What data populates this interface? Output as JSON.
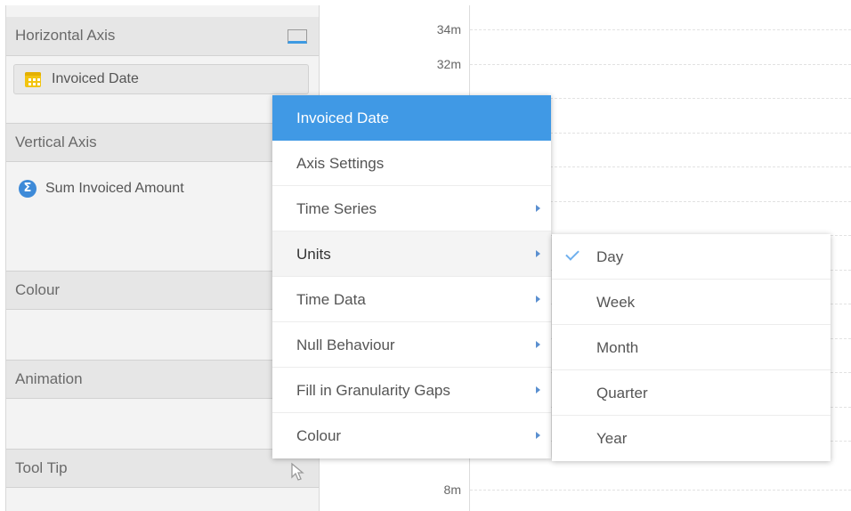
{
  "left_panel": {
    "horizontal_axis": {
      "title": "Horizontal Axis",
      "icon": "monitor-icon",
      "field": {
        "label": "Invoiced Date",
        "icon": "calendar-icon",
        "accent": "#f2c40f"
      }
    },
    "vertical_axis": {
      "title": "Vertical Axis",
      "field": {
        "label": "Sum Invoiced Amount",
        "icon": "sigma-icon",
        "icon_text": "Σ",
        "accent": "#3d8ad8"
      }
    },
    "colour": {
      "title": "Colour"
    },
    "animation": {
      "title": "Animation"
    },
    "tool_tip": {
      "title": "Tool Tip",
      "icon": "cursor-icon"
    }
  },
  "chart": {
    "y_ticks": [
      {
        "label": "34m"
      },
      {
        "label": "32m"
      },
      {
        "label": "8m"
      }
    ]
  },
  "context_menu": {
    "items": [
      {
        "label": "Invoiced Date",
        "state": "header"
      },
      {
        "label": "Axis Settings",
        "has_submenu": false
      },
      {
        "label": "Time Series",
        "has_submenu": true
      },
      {
        "label": "Units",
        "has_submenu": true,
        "state": "active"
      },
      {
        "label": "Time Data",
        "has_submenu": true
      },
      {
        "label": "Null Behaviour",
        "has_submenu": true
      },
      {
        "label": "Fill in Granularity Gaps",
        "has_submenu": true
      },
      {
        "label": "Colour",
        "has_submenu": true
      }
    ],
    "accent_color": "#4099e5"
  },
  "units_submenu": {
    "items": [
      {
        "label": "Day",
        "checked": true
      },
      {
        "label": "Week",
        "checked": false
      },
      {
        "label": "Month",
        "checked": false
      },
      {
        "label": "Quarter",
        "checked": false
      },
      {
        "label": "Year",
        "checked": false
      }
    ]
  }
}
